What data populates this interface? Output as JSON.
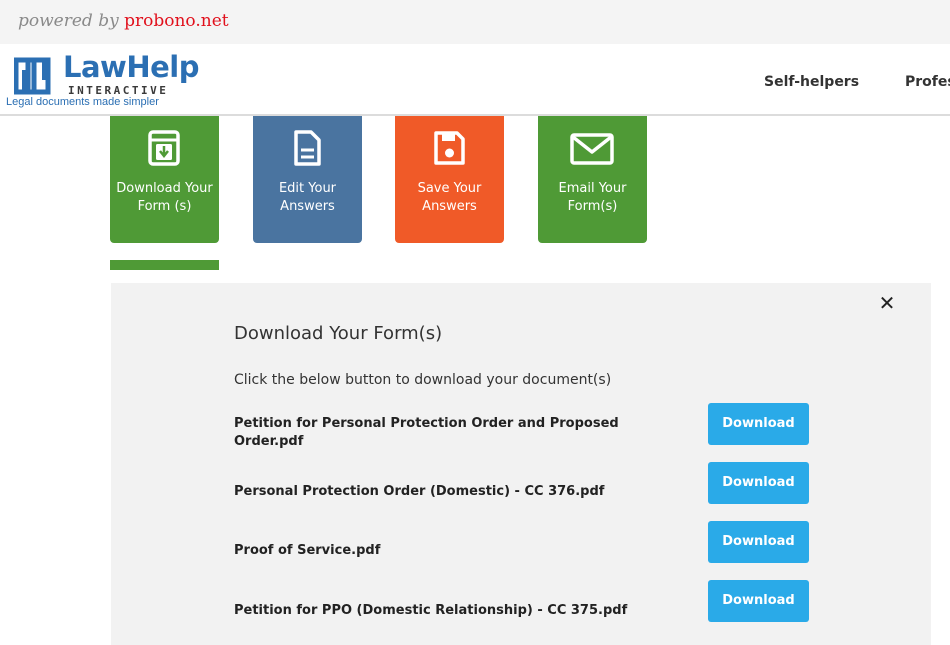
{
  "powered": {
    "prefix": "powered by",
    "brand": "probono.net"
  },
  "logo": {
    "law": "Law",
    "help": "Help",
    "interactive": "INTERACTIVE",
    "tagline": "Legal documents made simpler"
  },
  "nav": {
    "items": [
      "Self-helpers",
      "Profes"
    ]
  },
  "tiles": [
    {
      "label": "Download Your Form (s)",
      "color": "#4f9a36",
      "icon": "download-box-icon"
    },
    {
      "label": "Edit Your Answers",
      "color": "#4a74a0",
      "icon": "document-icon"
    },
    {
      "label": "Save Your Answers",
      "color": "#f05a28",
      "icon": "floppy-disk-icon"
    },
    {
      "label": "Email Your Form(s)",
      "color": "#4f9a36",
      "icon": "envelope-icon"
    }
  ],
  "panel": {
    "title": "Download Your Form(s)",
    "instructions": "Click the below button to download your document(s)",
    "close_symbol": "✕",
    "documents": [
      {
        "name": "Petition for Personal Protection Order and Proposed Order.pdf",
        "button": "Download"
      },
      {
        "name": "Personal Protection Order (Domestic) - CC 376.pdf",
        "button": "Download"
      },
      {
        "name": "Proof of Service.pdf",
        "button": "Download"
      },
      {
        "name": "Petition for PPO (Domestic Relationship) - CC 375.pdf",
        "button": "Download"
      }
    ]
  }
}
